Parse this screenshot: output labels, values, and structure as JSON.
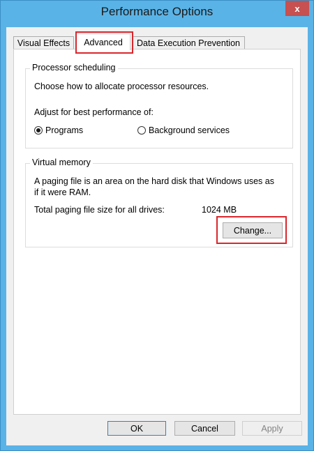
{
  "window": {
    "title": "Performance Options",
    "close_glyph": "x"
  },
  "tabs": [
    {
      "label": "Visual Effects",
      "active": false
    },
    {
      "label": "Advanced",
      "active": true
    },
    {
      "label": "Data Execution Prevention",
      "active": false
    }
  ],
  "processor": {
    "title": "Processor scheduling",
    "description": "Choose how to allocate processor resources.",
    "adjust_label": "Adjust for best performance of:",
    "options": [
      {
        "label": "Programs",
        "checked": true
      },
      {
        "label": "Background services",
        "checked": false
      }
    ]
  },
  "virtual_memory": {
    "title": "Virtual memory",
    "description_line1": "A paging file is an area on the hard disk that Windows uses as",
    "description_line2": "if it were RAM.",
    "total_label": "Total paging file size for all drives:",
    "total_value": "1024 MB",
    "change_label": "Change..."
  },
  "buttons": {
    "ok": "OK",
    "cancel": "Cancel",
    "apply": "Apply"
  },
  "colors": {
    "frame": "#5ab3e6",
    "close": "#c75050",
    "highlight": "#d9262c"
  }
}
